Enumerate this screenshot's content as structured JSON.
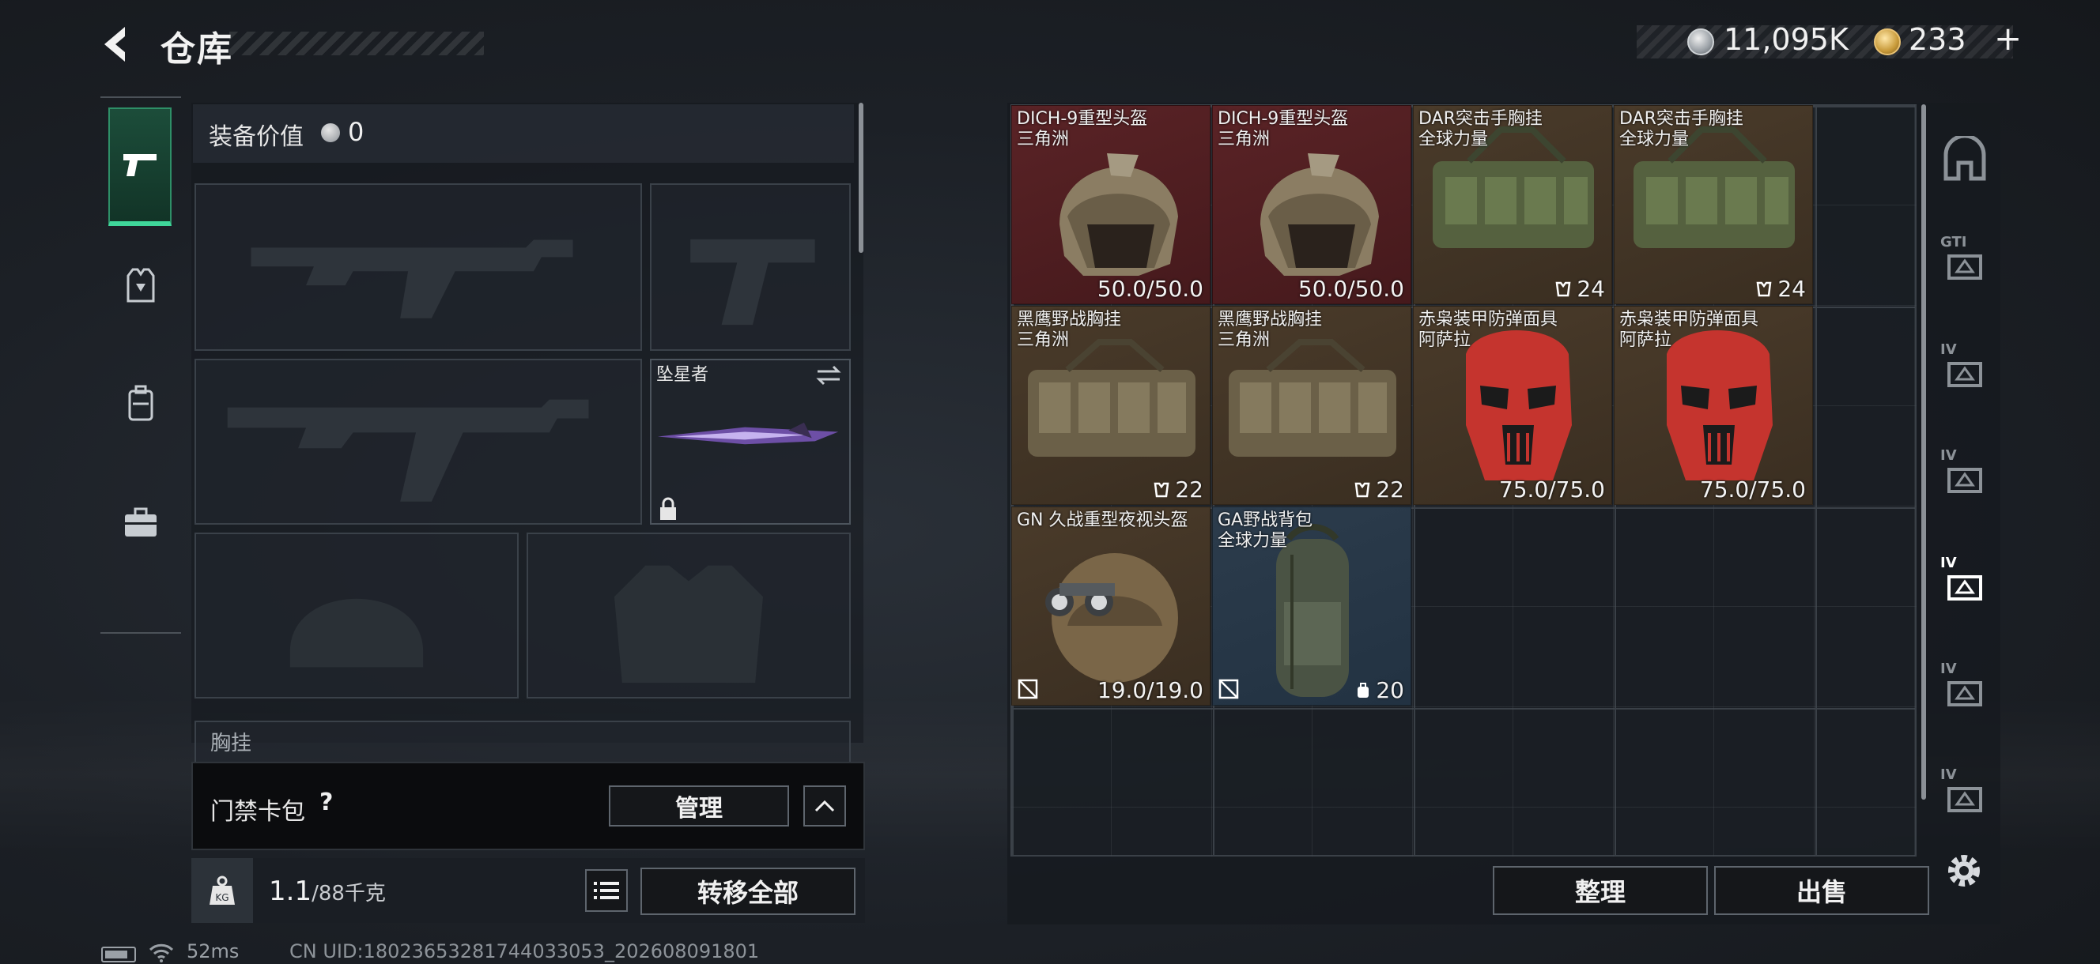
{
  "header": {
    "title": "仓库",
    "currency1": "11,095K",
    "currency2": "233",
    "plus": "+"
  },
  "tabs": [
    {
      "id": "weapons",
      "icon": "pistol-icon",
      "active": true
    },
    {
      "id": "armor",
      "icon": "vest-icon",
      "active": false
    },
    {
      "id": "backpack",
      "icon": "backpack-icon",
      "active": false
    },
    {
      "id": "kit",
      "icon": "briefcase-icon",
      "active": false
    }
  ],
  "equipment": {
    "value_label": "装备价值",
    "value": "0",
    "melee_name": "坠星者",
    "vest_label": "胸挂"
  },
  "card_pack": {
    "label": "门禁卡包",
    "help": "?",
    "manage": "管理"
  },
  "weight": {
    "current": "1.1",
    "max": "/88千克",
    "kg_icon": "KG",
    "transfer": "转移全部"
  },
  "status": {
    "ping": "52ms",
    "uid": "CN UID:18023653281744033053_202608091801"
  },
  "warehouse": {
    "items": [
      {
        "name": "DICH-9重型头盔",
        "sub": "三角洲",
        "value": "50.0/50.0",
        "kind": "helmet",
        "bg": "red",
        "icon": ""
      },
      {
        "name": "DICH-9重型头盔",
        "sub": "三角洲",
        "value": "50.0/50.0",
        "kind": "helmet",
        "bg": "red",
        "icon": ""
      },
      {
        "name": "DAR突击手胸挂",
        "sub": "全球力量",
        "value": "24",
        "kind": "vest-green",
        "bg": "brown",
        "icon": "grid-capacity-icon"
      },
      {
        "name": "DAR突击手胸挂",
        "sub": "全球力量",
        "value": "24",
        "kind": "vest-green",
        "bg": "brown",
        "icon": "grid-capacity-icon"
      },
      {
        "name": "黑鹰野战胸挂",
        "sub": "三角洲",
        "value": "22",
        "kind": "vest-tan",
        "bg": "brown",
        "icon": "grid-capacity-icon"
      },
      {
        "name": "黑鹰野战胸挂",
        "sub": "三角洲",
        "value": "22",
        "kind": "vest-tan",
        "bg": "brown",
        "icon": "grid-capacity-icon"
      },
      {
        "name": "赤枭装甲防弹面具",
        "sub": "阿萨拉",
        "value": "75.0/75.0",
        "kind": "mask",
        "bg": "brown",
        "icon": ""
      },
      {
        "name": "赤枭装甲防弹面具",
        "sub": "阿萨拉",
        "value": "75.0/75.0",
        "kind": "mask",
        "bg": "brown",
        "icon": ""
      },
      {
        "name": "GN 久战重型夜视头盔",
        "sub": "",
        "value": "19.0/19.0",
        "kind": "nvg",
        "bg": "brown",
        "icon": "no-sell-icon"
      },
      {
        "name": "GA野战背包",
        "sub": "全球力量",
        "value": "20",
        "kind": "bag",
        "bg": "blue",
        "icon": "backpack-capacity-icon"
      }
    ],
    "sort": "整理",
    "sell": "出售"
  },
  "rail": [
    {
      "icon": "storage-icon",
      "label": ""
    },
    {
      "icon": "gti-crate-icon",
      "label": "GTI"
    },
    {
      "icon": "tier4-armor-icon",
      "label": "IV"
    },
    {
      "icon": "tier4-helmet-icon",
      "label": "IV"
    },
    {
      "icon": "tier4-selected-icon",
      "label": "IV"
    },
    {
      "icon": "tier4-weapon-icon",
      "label": "IV"
    },
    {
      "icon": "tier4-medkit-icon",
      "label": "IV"
    }
  ],
  "colors": {
    "accent": "#3fd69a",
    "red_bg": "#5a2326",
    "brown_bg": "#4a3b2a",
    "blue_bg": "#2c3c4c"
  }
}
